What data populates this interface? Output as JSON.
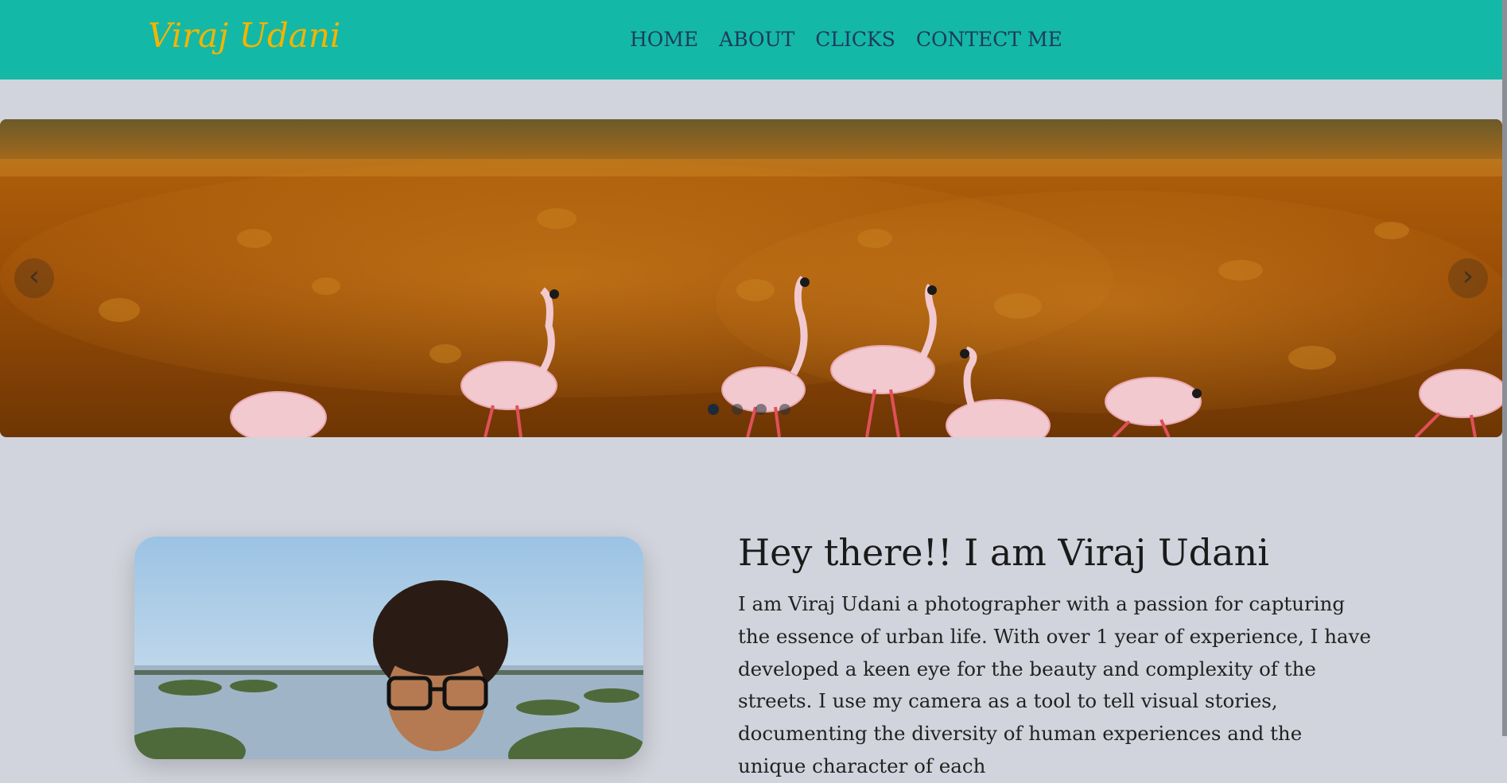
{
  "nav": {
    "brand": "Viraj Udani",
    "links": [
      "HOME",
      "ABOUT",
      "CLICKS",
      "CONTECT ME"
    ]
  },
  "carousel": {
    "prev_icon": "chevron-left-icon",
    "next_icon": "chevron-right-icon",
    "prev_label": "‹",
    "next_label": "›",
    "slide_count": 4,
    "active_slide": 1
  },
  "about": {
    "title": "Hey there!! I am Viraj Udani",
    "text": "I am Viraj Udani a photographer with a passion for capturing the essence of urban life. With over 1 year of experience, I have developed a keen eye for the beauty and complexity of the streets. I use my camera as a tool to tell visual stories, documenting the diversity of human experiences and the unique character of each"
  },
  "colors": {
    "navbar": "#14b8a6",
    "brand": "#f4b400",
    "nav_link": "#1f3a5f",
    "background": "#d1d4dc"
  }
}
